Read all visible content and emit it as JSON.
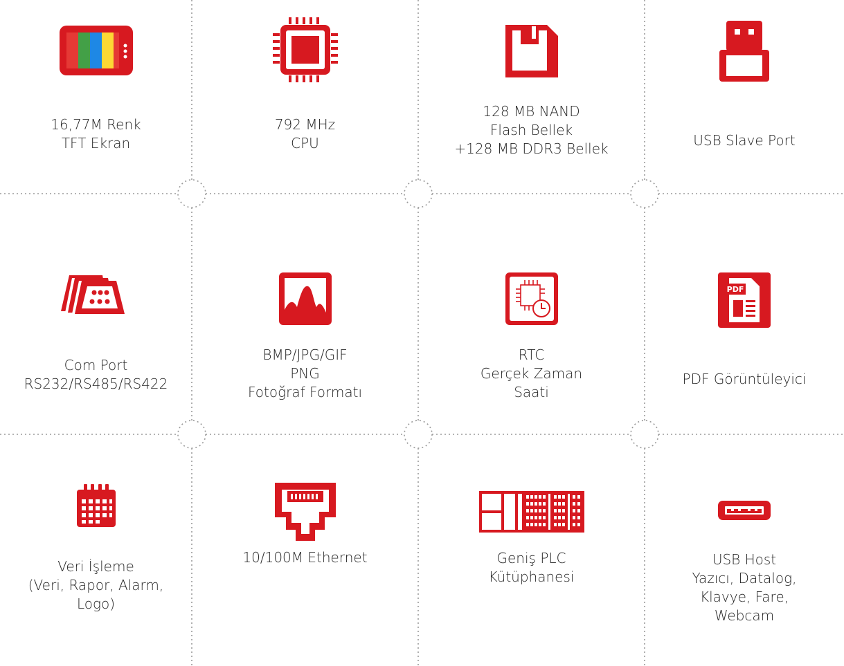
{
  "features": [
    {
      "icon": "color-tv-screen-icon",
      "lines": [
        "16,77M Renk",
        "TFT Ekran"
      ]
    },
    {
      "icon": "cpu-chip-icon",
      "lines": [
        "792 MHz",
        "CPU"
      ]
    },
    {
      "icon": "flash-memory-icon",
      "lines": [
        "128 MB NAND",
        "Flash Bellek",
        "+128 MB DDR3 Bellek"
      ]
    },
    {
      "icon": "usb-slave-connector-icon",
      "lines": [
        "USB Slave Port"
      ]
    },
    {
      "icon": "serial-port-icon",
      "lines": [
        "Com Port",
        "RS232/RS485/RS422"
      ]
    },
    {
      "icon": "image-photo-icon",
      "lines": [
        "BMP/JPG/GIF",
        "PNG",
        "Fotoğraf Formatı"
      ]
    },
    {
      "icon": "rtc-clock-chip-icon",
      "lines": [
        "RTC",
        "Gerçek Zaman",
        "Saati"
      ]
    },
    {
      "icon": "pdf-document-icon",
      "lines": [
        "PDF Görüntüleyici"
      ]
    },
    {
      "icon": "calendar-icon",
      "lines": [
        "Veri İşleme",
        "(Veri, Rapor, Alarm,",
        "Logo)"
      ]
    },
    {
      "icon": "ethernet-port-icon",
      "lines": [
        "10/100M Ethernet"
      ]
    },
    {
      "icon": "plc-library-icon",
      "lines": [
        "Geniş PLC",
        "Kütüphanesi"
      ]
    },
    {
      "icon": "usb-host-connector-icon",
      "lines": [
        "USB Host",
        "Yazıcı, Datalog,",
        "Klavye, Fare,",
        "Webcam"
      ]
    }
  ],
  "colors": {
    "accent": "#d71920",
    "grid_line": "#9a9a9a"
  }
}
